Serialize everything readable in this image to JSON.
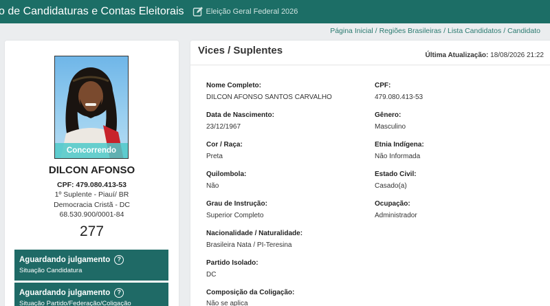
{
  "header": {
    "app_title": "o de Candidaturas e Contas Eleitorais",
    "election": "Eleição Geral Federal 2026",
    "colors": {
      "bar": "#1c6e66",
      "accent": "#1f6a66"
    },
    "icon": "edit-icon"
  },
  "breadcrumb": {
    "items": [
      "Página Inicial",
      "Regiões Brasileiras",
      "Lista Candidatos",
      "Candidato"
    ],
    "separator": "/"
  },
  "candidate": {
    "badge": "Concorrendo",
    "name": "DILCON AFONSO",
    "cpf": "CPF: 479.080.413-53",
    "role": "1º Suplente - Piauí/ BR",
    "party": "Democracia Cristã - DC",
    "cnpj": "68.530.900/0001-84",
    "number": "277",
    "status": [
      {
        "title": "Aguardando julgamento",
        "subtitle": "Situação Candidatura"
      },
      {
        "title": "Aguardando julgamento",
        "subtitle": "Situação Partido/Federação/Coligação"
      }
    ],
    "help_icon": "?"
  },
  "details": {
    "title": "Vices / Suplentes",
    "last_update_label": "Última Atualização:",
    "last_update_value": "18/08/2026 21:22",
    "left_fields": [
      {
        "label": "Nome Completo:",
        "value": "DILCON AFONSO SANTOS CARVALHO"
      },
      {
        "label": "Data de Nascimento:",
        "value": "23/12/1967"
      },
      {
        "label": "Cor / Raça:",
        "value": "Preta"
      },
      {
        "label": "Quilombola:",
        "value": "Não"
      },
      {
        "label": "Grau de Instrução:",
        "value": "Superior Completo"
      },
      {
        "label": "Nacionalidade / Naturalidade:",
        "value": "Brasileira Nata / PI-Teresina"
      },
      {
        "label": "Partido Isolado:",
        "value": "DC"
      },
      {
        "label": "Composição da Coligação:",
        "value": "Não se aplica"
      }
    ],
    "right_fields": [
      {
        "label": "CPF:",
        "value": "479.080.413-53"
      },
      {
        "label": "Gênero:",
        "value": "Masculino"
      },
      {
        "label": "Etnia Indígena:",
        "value": "Não Informada"
      },
      {
        "label": "Estado Civil:",
        "value": "Casado(a)"
      },
      {
        "label": "Ocupação:",
        "value": "Administrador"
      }
    ]
  }
}
